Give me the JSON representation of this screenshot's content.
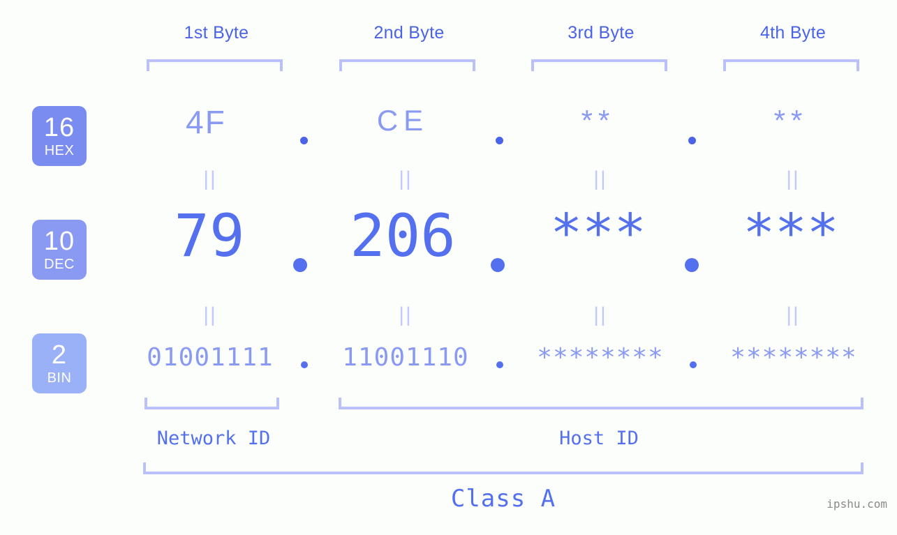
{
  "meta": {
    "background_color": "#fcfefb",
    "accent_color": "#5470ee",
    "accent_light": "#8a99f2",
    "bracket_color": "#b9c0fb",
    "watermark": "ipshu.com"
  },
  "columns": [
    {
      "header": "1st Byte"
    },
    {
      "header": "2nd Byte"
    },
    {
      "header": "3rd Byte"
    },
    {
      "header": "4th Byte"
    }
  ],
  "bases": [
    {
      "number": "16",
      "name": "HEX",
      "color": "#7a8cf0"
    },
    {
      "number": "10",
      "name": "DEC",
      "color": "#8a99f2"
    },
    {
      "number": "2",
      "name": "BIN",
      "color": "#9ab0f7"
    }
  ],
  "rows": {
    "hex": {
      "values": [
        "4F",
        "CE",
        "**",
        "**"
      ]
    },
    "dec": {
      "values": [
        "79",
        "206",
        "***",
        "***"
      ]
    },
    "bin": {
      "values": [
        "01001111",
        "11001110",
        "********",
        "********"
      ]
    }
  },
  "separators": {
    "dot": "."
  },
  "equals_marker": "||",
  "footer": {
    "network_id": "Network ID",
    "host_id": "Host ID",
    "class": "Class A"
  }
}
